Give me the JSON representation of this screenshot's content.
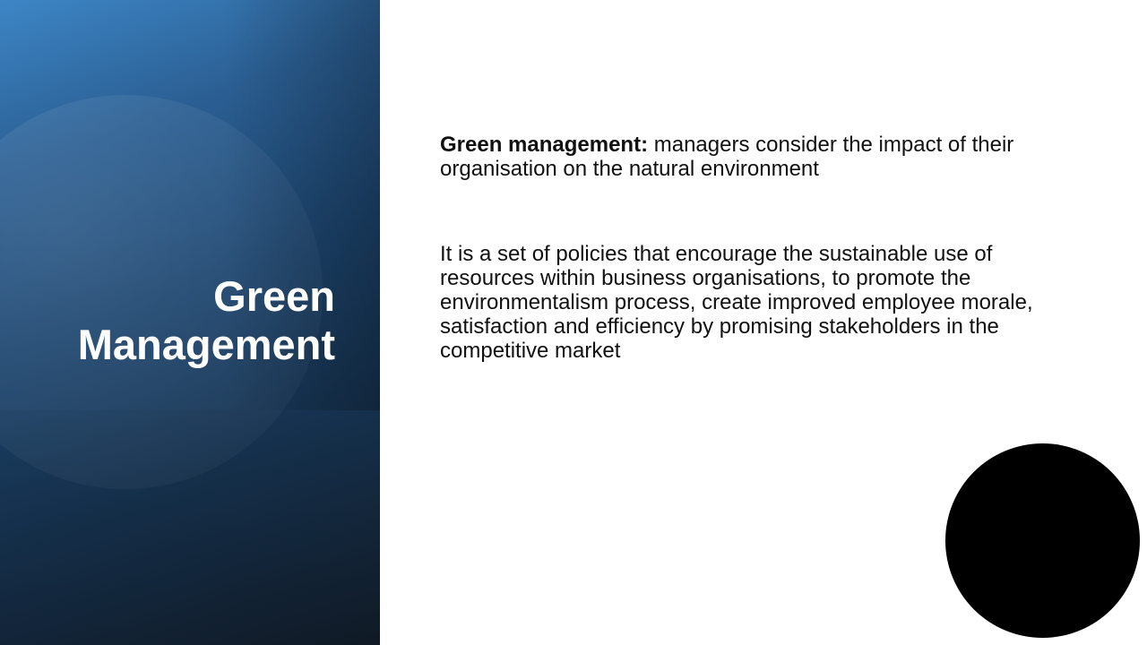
{
  "slide": {
    "title_line1": "Green",
    "title_line2": "Management",
    "definition": {
      "term": "Green management:",
      "text": " managers consider the impact of their organisation on the natural environment"
    },
    "description": "It is a set of policies that encourage the sustainable use of resources within business organisations, to promote the environmentalism process, create improved employee morale, satisfaction and efficiency by promising stakeholders in the competitive market"
  },
  "colors": {
    "panel_light": "#3d86c6",
    "panel_dark": "#121d2a",
    "title_text": "#ffffff",
    "body_text": "#111111",
    "corner_circle": "#000000"
  }
}
